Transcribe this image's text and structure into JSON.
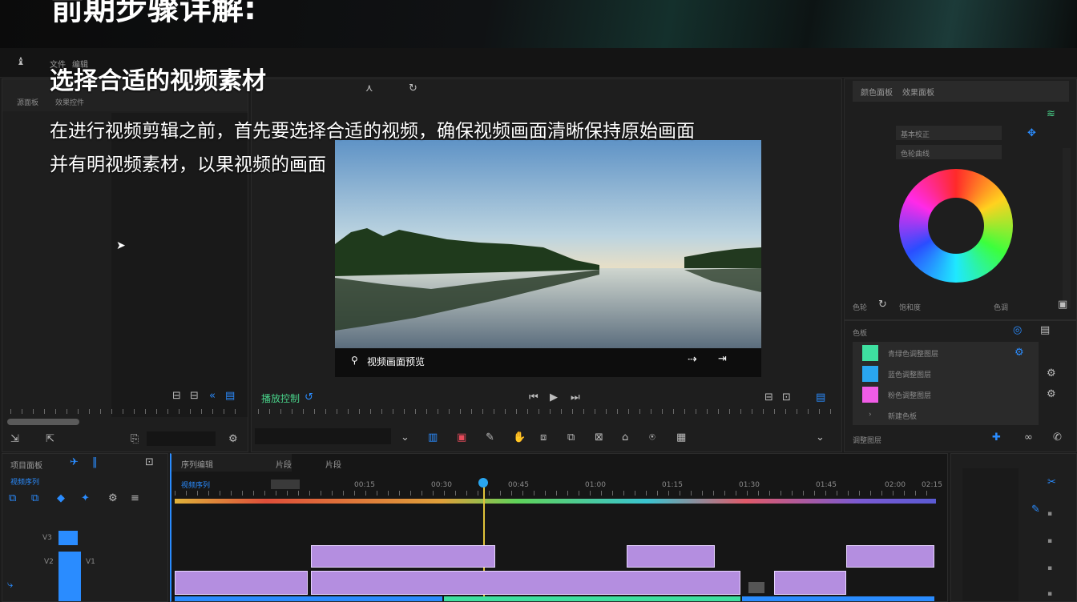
{
  "banner": {
    "title": "前期步骤详解:"
  },
  "overlay": {
    "heading": "选择合适的视频素材",
    "line1": "在进行视频剪辑之前，首先要选择合适的视频，确保视频画面清晰保持原始画面",
    "line2": "并有明视频素材，以果视频的画面"
  },
  "menubar": {
    "items": [
      "文件",
      "编辑"
    ]
  },
  "source_panel": {
    "tab1": "源面板",
    "tab2": "效果控件"
  },
  "program_panel": {
    "caption": "视频画面预览",
    "controls_label": "播放控制"
  },
  "lumetri": {
    "tab1": "颜色面板",
    "tab2": "效果面板",
    "row1": "基本校正",
    "row2": "色轮曲线",
    "bottom_left": "色轮",
    "bottom_mid": "饱和度",
    "bottom_right": "色调"
  },
  "swatches": {
    "title": "色板",
    "items": [
      {
        "label": "青绿色调整图层",
        "color": "#3ee0a0"
      },
      {
        "label": "蓝色调整图层",
        "color": "#29a6f0"
      },
      {
        "label": "粉色调整图层",
        "color": "#f05ce6"
      },
      {
        "label": "新建色板",
        "color": ""
      }
    ],
    "footer": "调整图层"
  },
  "timeline": {
    "tab_project": "项目面板",
    "tab_seq": "序列编辑",
    "tab_other": "片段",
    "sequence_name": "视频序列",
    "ruler_labels": [
      "00:15",
      "00:30",
      "00:45",
      "01:00",
      "01:15",
      "01:30",
      "01:45",
      "02:00",
      "02:15"
    ],
    "track_labels": [
      "V3",
      "V2",
      "V1"
    ],
    "accent": "#29a6f0",
    "playhead_color": "#29a6f0"
  }
}
